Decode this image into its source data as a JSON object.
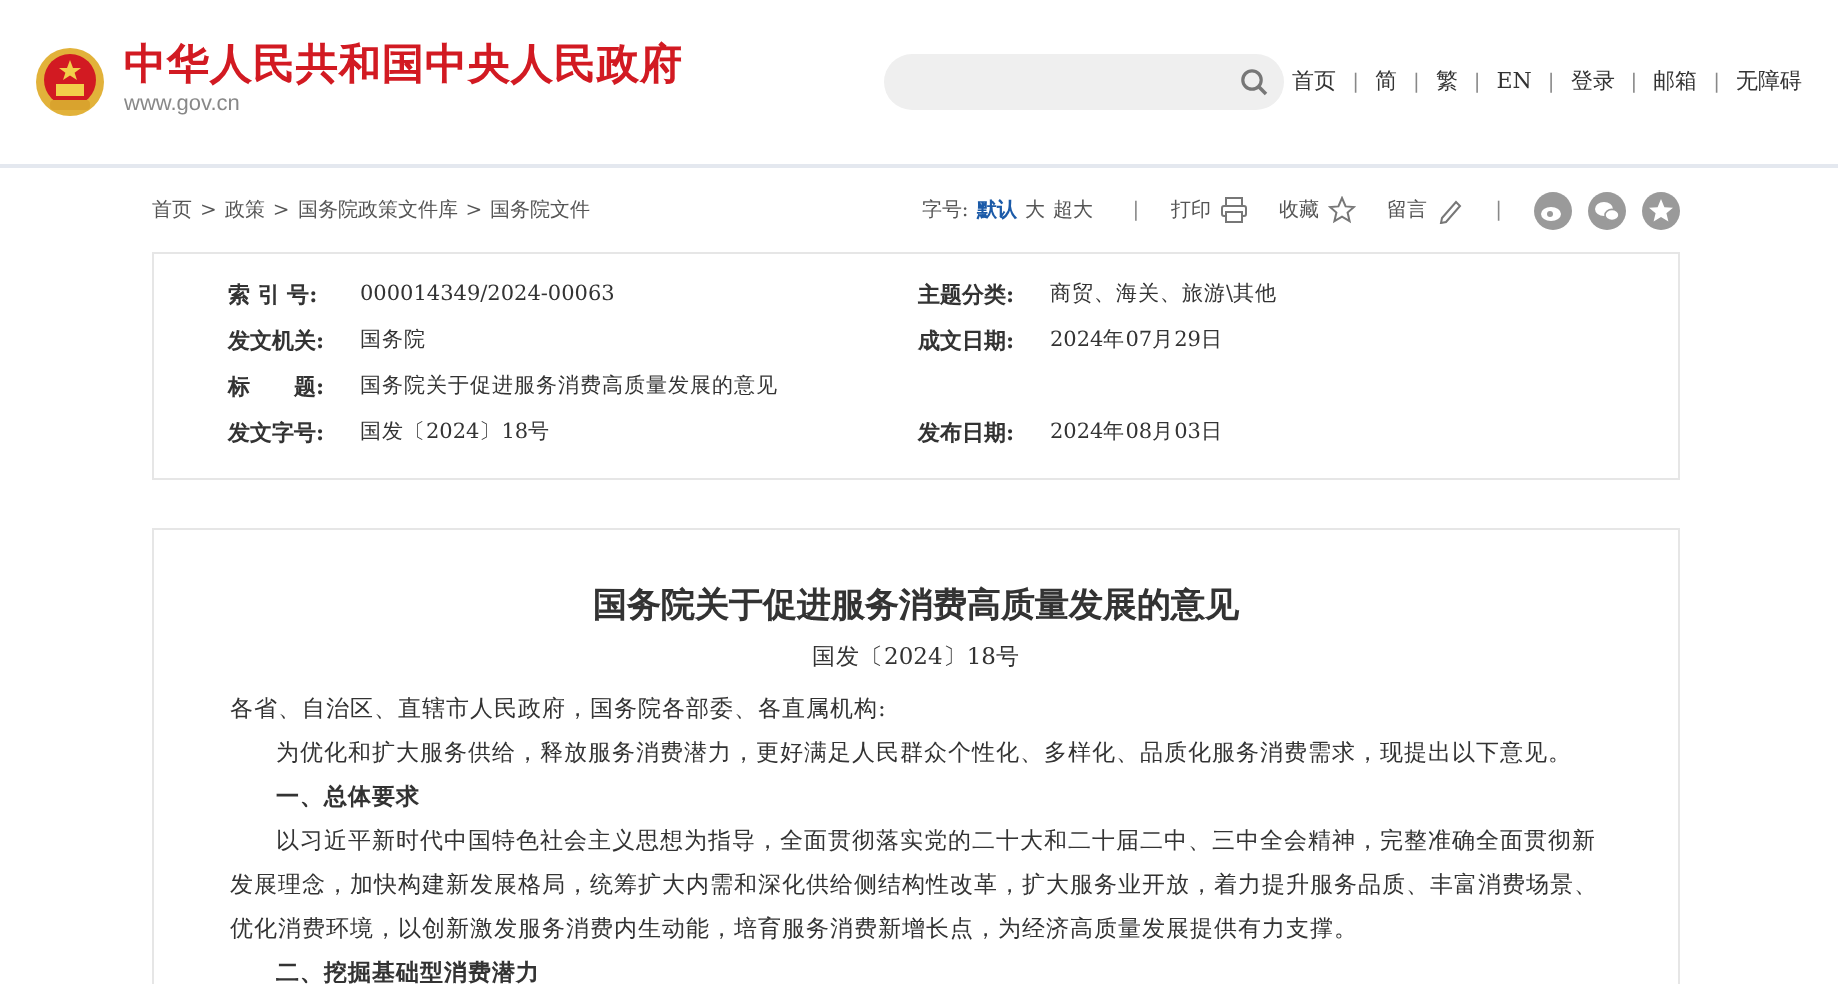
{
  "header": {
    "site_name": "中华人民共和国中央人民政府",
    "url": "www.gov.cn",
    "nav_separator": "|",
    "nav_links": [
      "首页",
      "简",
      "繁",
      "EN",
      "登录",
      "邮箱",
      "无障碍"
    ]
  },
  "breadcrumb": {
    "separator": ">",
    "items": [
      "首页",
      "政策",
      "国务院政策文件库",
      "国务院文件"
    ]
  },
  "toolbar": {
    "font_size_label": "字号:",
    "font_sizes": [
      {
        "label": "默认",
        "selected": true
      },
      {
        "label": "大",
        "selected": false
      },
      {
        "label": "超大",
        "selected": false
      }
    ],
    "actions": [
      {
        "label": "打印",
        "kind": "print"
      },
      {
        "label": "收藏",
        "kind": "favorite"
      },
      {
        "label": "留言",
        "kind": "comment"
      }
    ]
  },
  "info": [
    [
      {
        "label": "索 引 号:",
        "value": "000014349/2024-00063"
      },
      {
        "label": "主题分类:",
        "value": "商贸、海关、旅游\\其他"
      }
    ],
    [
      {
        "label": "发文机关:",
        "value": "国务院"
      },
      {
        "label": "成文日期:",
        "value": "2024年07月29日"
      }
    ],
    [
      {
        "label": "标　　题:",
        "value": "国务院关于促进服务消费高质量发展的意见"
      }
    ],
    [
      {
        "label": "发文字号:",
        "value": "国发〔2024〕18号"
      },
      {
        "label": "发布日期:",
        "value": "2024年08月03日"
      }
    ]
  ],
  "article": {
    "title": "国务院关于促进服务消费高质量发展的意见",
    "doc_number": "国发〔2024〕18号",
    "salutation": "各省、自治区、直辖市人民政府，国务院各部委、各直属机构:",
    "paragraphs": [
      {
        "kind": "body",
        "text": "为优化和扩大服务供给，释放服务消费潜力，更好满足人民群众个性化、多样化、品质化服务消费需求，现提出以下意见。"
      },
      {
        "kind": "heading",
        "text": "一、总体要求"
      },
      {
        "kind": "body",
        "text": "以习近平新时代中国特色社会主义思想为指导，全面贯彻落实党的二十大和二十届二中、三中全会精神，完整准确全面贯彻新发展理念，加快构建新发展格局，统筹扩大内需和深化供给侧结构性改革，扩大服务业开放，着力提升服务品质、丰富消费场景、优化消费环境，以创新激发服务消费内生动能，培育服务消费新增长点，为经济高质量发展提供有力支撑。"
      },
      {
        "kind": "heading",
        "text": "二、挖掘基础型消费潜力"
      }
    ]
  }
}
